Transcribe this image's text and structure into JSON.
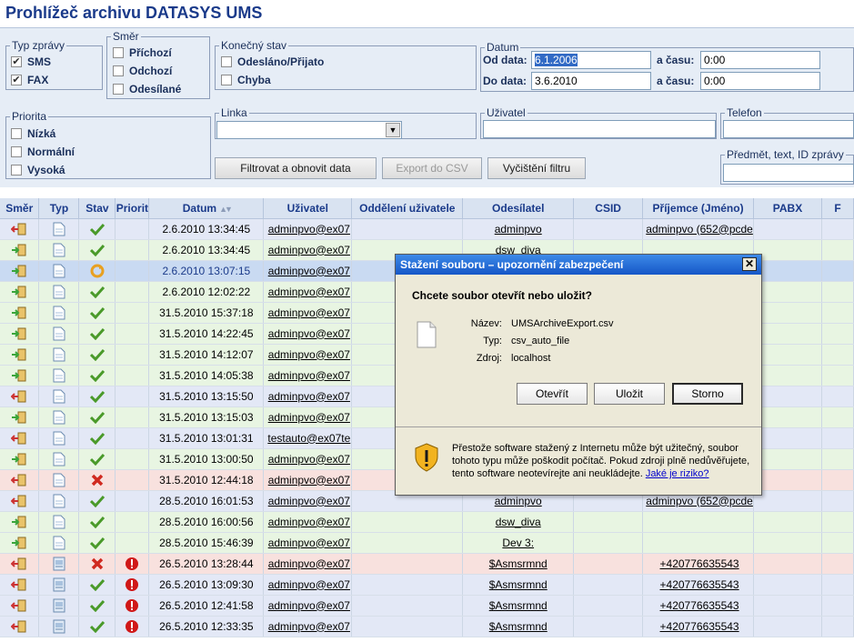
{
  "app": {
    "title": "Prohlížeč archivu DATASYS UMS"
  },
  "filters": {
    "message_type": {
      "legend": "Typ zprávy",
      "sms": "SMS",
      "fax": "FAX"
    },
    "direction": {
      "legend": "Směr",
      "incoming": "Příchozí",
      "outgoing": "Odchozí",
      "sending": "Odesílané"
    },
    "final_state": {
      "legend": "Konečný stav",
      "sent_received": "Odesláno/Přijato",
      "error": "Chyba"
    },
    "date": {
      "legend": "Datum",
      "from_label": "Od data:",
      "from_value": "6.1.2006",
      "to_label": "Do data:",
      "to_value": "3.6.2010",
      "time_label": "a času:",
      "time_from": "0:00",
      "time_to": "0:00"
    },
    "priority": {
      "legend": "Priorita",
      "low": "Nízká",
      "normal": "Normální",
      "high": "Vysoká"
    },
    "line": {
      "legend": "Linka"
    },
    "user": {
      "legend": "Uživatel"
    },
    "phone": {
      "legend": "Telefon"
    },
    "subject": {
      "legend": "Předmět, text, ID zprávy"
    },
    "buttons": {
      "filter": "Filtrovat a obnovit data",
      "export": "Export do CSV",
      "clear": "Vyčištění filtru"
    }
  },
  "table": {
    "columns": [
      "Směr",
      "Typ",
      "Stav",
      "Priorit",
      "Datum",
      "Uživatel",
      "Oddělení uživatele",
      "Odesílatel",
      "CSID",
      "Příjemce (Jméno)",
      "PABX",
      "F"
    ],
    "rows": [
      {
        "dir": "out",
        "type": "doc",
        "state": "ok",
        "prio": "",
        "date": "2.6.2010 13:34:45",
        "user": "adminpvo@ex07",
        "sender": "adminpvo",
        "recipient": "adminpvo (652@pcde",
        "bg": "blue"
      },
      {
        "dir": "in",
        "type": "doc",
        "state": "ok",
        "prio": "",
        "date": "2.6.2010 13:34:45",
        "user": "adminpvo@ex07",
        "sender": "dsw_diva",
        "recipient": "",
        "bg": "green"
      },
      {
        "dir": "in",
        "type": "doc",
        "state": "pending",
        "prio": "",
        "date": "2.6.2010 13:07:15",
        "user": "adminpvo@ex07",
        "sender": "",
        "recipient": "",
        "bg": "sel"
      },
      {
        "dir": "in",
        "type": "doc",
        "state": "ok",
        "prio": "",
        "date": "2.6.2010 12:02:22",
        "user": "adminpvo@ex07",
        "sender": "",
        "recipient": "",
        "bg": "green"
      },
      {
        "dir": "in",
        "type": "doc",
        "state": "ok",
        "prio": "",
        "date": "31.5.2010 15:37:18",
        "user": "adminpvo@ex07",
        "sender": "",
        "recipient": "",
        "bg": "green"
      },
      {
        "dir": "in",
        "type": "doc",
        "state": "ok",
        "prio": "",
        "date": "31.5.2010 14:22:45",
        "user": "adminpvo@ex07",
        "sender": "",
        "recipient": "",
        "bg": "green"
      },
      {
        "dir": "in",
        "type": "doc",
        "state": "ok",
        "prio": "",
        "date": "31.5.2010 14:12:07",
        "user": "adminpvo@ex07",
        "sender": "",
        "recipient": "",
        "bg": "green"
      },
      {
        "dir": "in",
        "type": "doc",
        "state": "ok",
        "prio": "",
        "date": "31.5.2010 14:05:38",
        "user": "adminpvo@ex07",
        "sender": "",
        "recipient": "",
        "bg": "green"
      },
      {
        "dir": "out",
        "type": "doc",
        "state": "ok",
        "prio": "",
        "date": "31.5.2010 13:15:50",
        "user": "adminpvo@ex07",
        "sender": "",
        "recipient": "",
        "bg": "blue"
      },
      {
        "dir": "in",
        "type": "doc",
        "state": "ok",
        "prio": "",
        "date": "31.5.2010 13:15:03",
        "user": "adminpvo@ex07",
        "sender": "",
        "recipient": "",
        "bg": "green"
      },
      {
        "dir": "out",
        "type": "doc",
        "state": "ok",
        "prio": "",
        "date": "31.5.2010 13:01:31",
        "user": "testauto@ex07te",
        "sender": "",
        "recipient": "",
        "bg": "blue"
      },
      {
        "dir": "in",
        "type": "doc",
        "state": "ok",
        "prio": "",
        "date": "31.5.2010 13:00:50",
        "user": "adminpvo@ex07",
        "sender": "",
        "recipient": "",
        "bg": "green"
      },
      {
        "dir": "out",
        "type": "doc",
        "state": "fail",
        "prio": "",
        "date": "31.5.2010 12:44:18",
        "user": "adminpvo@ex07",
        "sender": "",
        "recipient": "",
        "bg": "red"
      },
      {
        "dir": "out",
        "type": "doc",
        "state": "ok",
        "prio": "",
        "date": "28.5.2010 16:01:53",
        "user": "adminpvo@ex07",
        "sender": "adminpvo",
        "recipient": "adminpvo (652@pcde",
        "bg": "blue"
      },
      {
        "dir": "in",
        "type": "doc",
        "state": "ok",
        "prio": "",
        "date": "28.5.2010 16:00:56",
        "user": "adminpvo@ex07",
        "sender": "dsw_diva",
        "recipient": "",
        "bg": "green"
      },
      {
        "dir": "in",
        "type": "doc",
        "state": "ok",
        "prio": "",
        "date": "28.5.2010 15:46:39",
        "user": "adminpvo@ex07",
        "sender": "Dev 3:",
        "recipient": "",
        "bg": "green"
      },
      {
        "dir": "out",
        "type": "sms",
        "state": "fail",
        "prio": "high",
        "date": "26.5.2010 13:28:44",
        "user": "adminpvo@ex07",
        "sender": "$Asmsrmnd",
        "recipient": "+420776635543",
        "bg": "red"
      },
      {
        "dir": "out",
        "type": "sms",
        "state": "ok",
        "prio": "high",
        "date": "26.5.2010 13:09:30",
        "user": "adminpvo@ex07",
        "sender": "$Asmsrmnd",
        "recipient": "+420776635543",
        "bg": "blue"
      },
      {
        "dir": "out",
        "type": "sms",
        "state": "ok",
        "prio": "high",
        "date": "26.5.2010 12:41:58",
        "user": "adminpvo@ex07",
        "sender": "$Asmsrmnd",
        "recipient": "+420776635543",
        "bg": "blue"
      },
      {
        "dir": "out",
        "type": "sms",
        "state": "ok",
        "prio": "high",
        "date": "26.5.2010 12:33:35",
        "user": "adminpvo@ex07",
        "sender": "$Asmsrmnd",
        "recipient": "+420776635543",
        "bg": "blue"
      }
    ]
  },
  "dialog": {
    "title": "Stažení souboru – upozornění zabezpečení",
    "question": "Chcete soubor otevřít nebo uložit?",
    "name_label": "Název:",
    "name_value": "UMSArchiveExport.csv",
    "type_label": "Typ:",
    "type_value": "csv_auto_file",
    "source_label": "Zdroj:",
    "source_value": "localhost",
    "open": "Otevřít",
    "save": "Uložit",
    "cancel": "Storno",
    "warning": "Přestože software stažený z Internetu může být užitečný, soubor tohoto typu může poškodit počítač. Pokud zdroji plně nedůvěřujete, tento software neotevírejte ani neukládejte.",
    "risk_link": "Jaké je riziko?"
  }
}
